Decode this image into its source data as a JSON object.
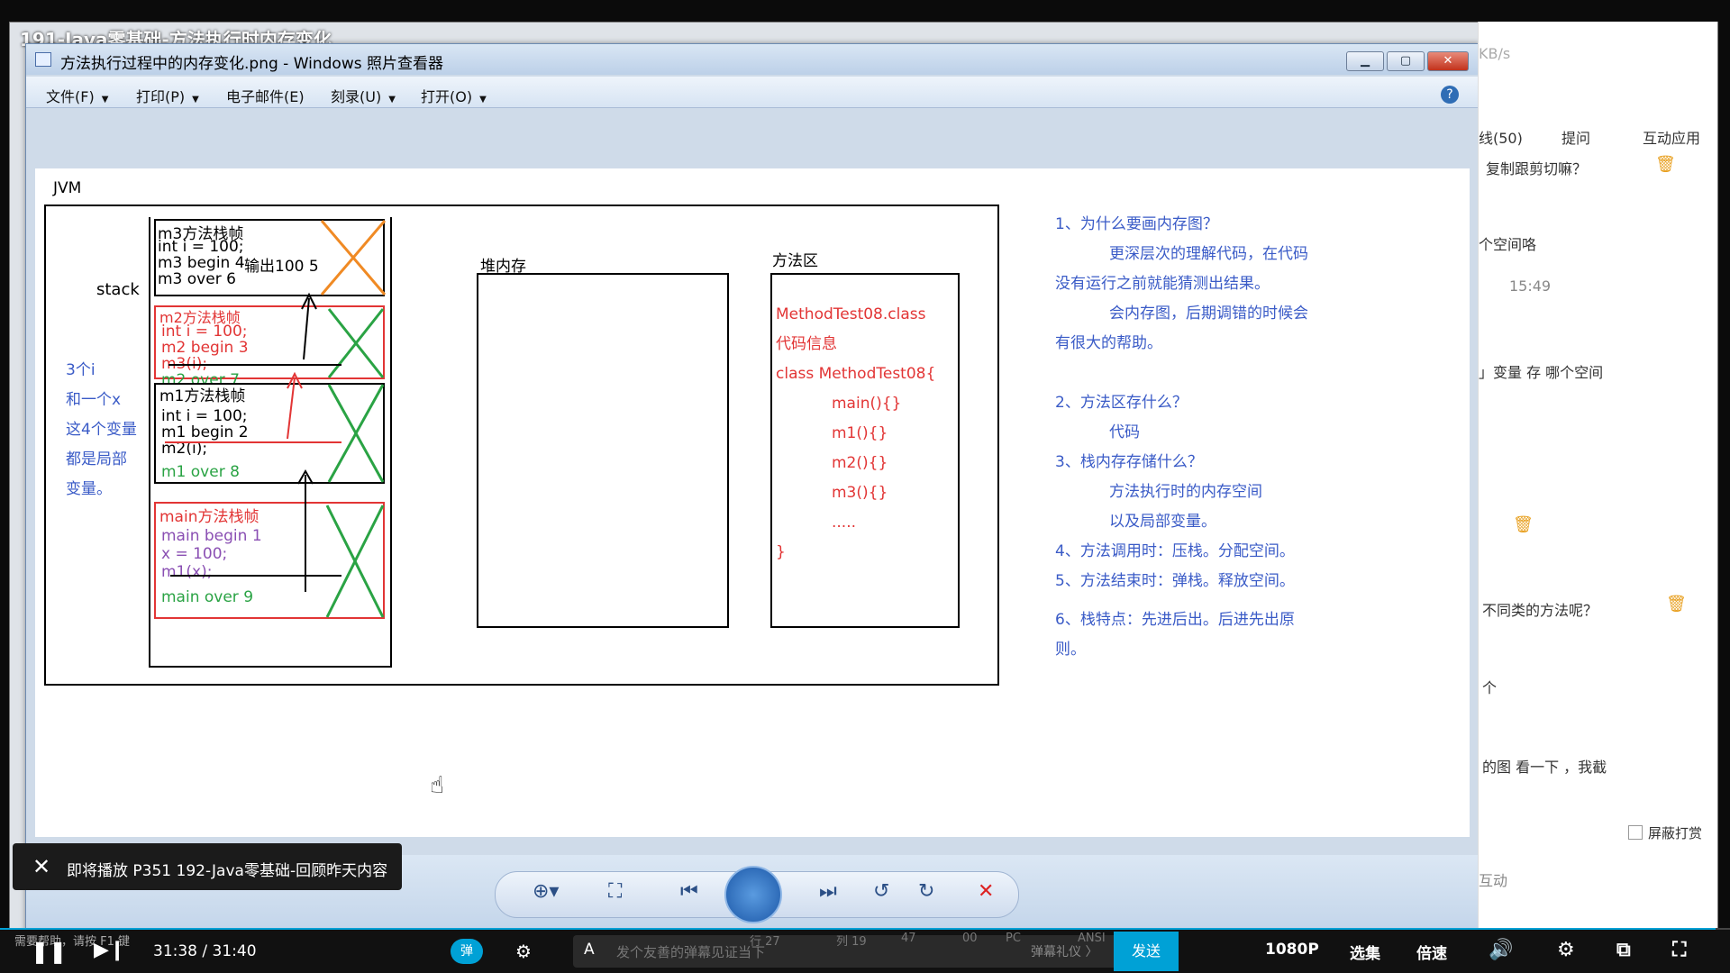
{
  "video": {
    "title": "191-Java零基础-方法执行时内存变化",
    "up_next_toast": "即将播放 P351 192-Java零基础-回顾昨天内容"
  },
  "viewer": {
    "window_title": "方法执行过程中的内存变化.png - Windows 照片查看器",
    "menu": [
      {
        "label": "文件(F)",
        "has_caret": true
      },
      {
        "label": "打印(P)",
        "has_caret": true
      },
      {
        "label": "电子邮件(E)",
        "has_caret": false
      },
      {
        "label": "刻录(U)",
        "has_caret": true
      },
      {
        "label": "打开(O)",
        "has_caret": true
      }
    ]
  },
  "diagram": {
    "jvm_label": "JVM",
    "stack_label": "stack",
    "heap_label": "堆内存",
    "method_area_label": "方法区",
    "left_note": [
      "3个i",
      "和一个x",
      "这4个变量",
      "都是局部",
      "变量。"
    ],
    "frames": {
      "m3": {
        "title": "m3方法栈帧",
        "lines": [
          "int i = 100;",
          "m3 begin  4",
          "m3 over  6"
        ],
        "output": "输出100  5"
      },
      "m2": {
        "title": "m2方法栈帧",
        "lines": [
          "int i = 100;",
          "m2 begin  3",
          "m3(i);",
          "m2 over  7"
        ]
      },
      "m1": {
        "title": "m1方法栈帧",
        "lines": [
          "int i = 100;",
          "m1 begin  2",
          "m2(i);",
          "m1 over   8"
        ]
      },
      "main": {
        "title": "main方法栈帧",
        "lines": [
          "main begin   1",
          "x = 100;",
          "m1(x);",
          "main over   9"
        ]
      }
    },
    "method_area_lines": [
      "MethodTest08.class",
      "代码信息",
      "class MethodTest08{",
      "main(){}",
      "m1(){}",
      "m2(){}",
      "m3(){}",
      ".....",
      "}"
    ],
    "notes": [
      "1、为什么要画内存图？",
      "更深层次的理解代码，在代码",
      "没有运行之前就能猜测出结果。",
      "会内存图，后期调错的时候会",
      "有很大的帮助。",
      "2、方法区存什么？",
      "代码",
      "3、栈内存存储什么？",
      "方法执行时的内存空间",
      "以及局部变量。",
      "4、方法调用时：压栈。分配空间。",
      "5、方法结束时：弹栈。释放空间。",
      "6、栈特点：先进后出。后进先出原",
      "则。"
    ]
  },
  "sidebar": {
    "tabs": [
      "线(50)",
      "提问",
      "互动应用"
    ],
    "speed": "KB/s",
    "messages": [
      "复制跟剪切嘛？",
      "个空间咯",
      "15:49",
      "」变量 存 哪个空间",
      "不同类的方法呢？",
      "个",
      "的图 看一下 ，我截"
    ],
    "block_gift": "屏蔽打赏",
    "interact": "互动"
  },
  "player": {
    "time": "31:38 / 31:40",
    "danmaku_placeholder": "发个友善的弹幕见证当下",
    "danmaku_etiquette": "弹幕礼仪 〉",
    "send": "发送",
    "quality": "1080P",
    "episodes": "选集",
    "speed": "倍速",
    "status_hint": "需要帮助，请按 F1 键",
    "status_fields": [
      "行 27",
      "列 19",
      "47",
      "00",
      "PC",
      "ANSI"
    ]
  },
  "colors": {
    "accent": "#00a1d6",
    "diagram_red": "#e23535",
    "diagram_green": "#2aa344",
    "diagram_blue": "#3a5bc7",
    "diagram_orange": "#f08a24"
  }
}
